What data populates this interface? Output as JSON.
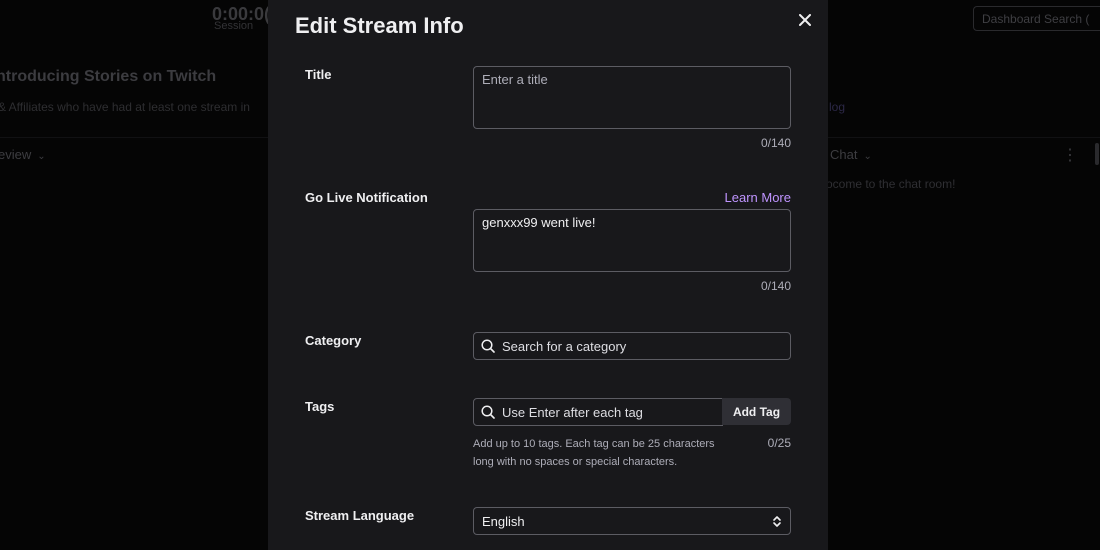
{
  "background": {
    "timer": "0:00:0(",
    "session_label": "Session",
    "search_label": "Dashboard Search (",
    "headline": "ntroducing Stories on Twitch",
    "subtext": "& Affiliates who have had at least one stream in",
    "link_text": "log",
    "preview_label": "eview",
    "chat_label": "Chat",
    "chat_welcome": "ocome to the chat room!"
  },
  "modal": {
    "title": "Edit Stream Info",
    "title_field": {
      "label": "Title",
      "placeholder": "Enter a title",
      "counter": "0/140"
    },
    "notification_field": {
      "label": "Go Live Notification",
      "learn_more": "Learn More",
      "value": "genxxx99 went live!",
      "counter": "0/140"
    },
    "category_field": {
      "label": "Category",
      "placeholder": "Search for a category"
    },
    "tags_field": {
      "label": "Tags",
      "placeholder": "Use Enter after each tag",
      "add_button": "Add Tag",
      "help_line_1": "Add up to 10 tags. Each tag can be 25 characters",
      "help_line_2": "long with no spaces or special characters.",
      "counter": "0/25"
    },
    "language_field": {
      "label": "Stream Language",
      "selected": "English"
    }
  },
  "colors": {
    "accent": "#bf94ff",
    "modal_bg": "#18181b",
    "border": "#5c5c63"
  }
}
